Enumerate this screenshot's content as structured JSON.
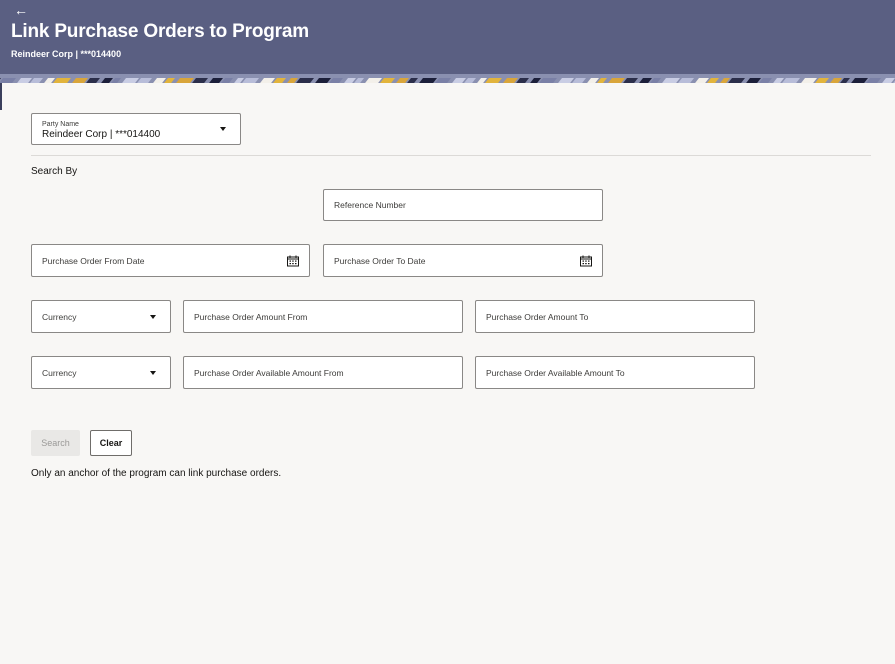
{
  "header": {
    "back_icon": "arrow-left-icon",
    "title": "Link Purchase Orders to Program",
    "subtitle": "Reindeer Corp | ***014400",
    "background_color": "#5a5f82"
  },
  "form": {
    "party_name": {
      "label": "Party Name",
      "value": "Reindeer Corp | ***014400"
    },
    "search_by_label": "Search By",
    "reference_number_placeholder": "Reference Number",
    "po_from_date_placeholder": "Purchase Order From Date",
    "po_to_date_placeholder": "Purchase Order To Date",
    "currency_1_placeholder": "Currency",
    "po_amount_from_placeholder": "Purchase Order Amount From",
    "po_amount_to_placeholder": "Purchase Order Amount To",
    "currency_2_placeholder": "Currency",
    "po_available_amount_from_placeholder": "Purchase Order Available Amount From",
    "po_available_amount_to_placeholder": "Purchase Order Available Amount To"
  },
  "actions": {
    "search_label": "Search",
    "clear_label": "Clear"
  },
  "note": "Only an anchor of the program can link purchase orders."
}
